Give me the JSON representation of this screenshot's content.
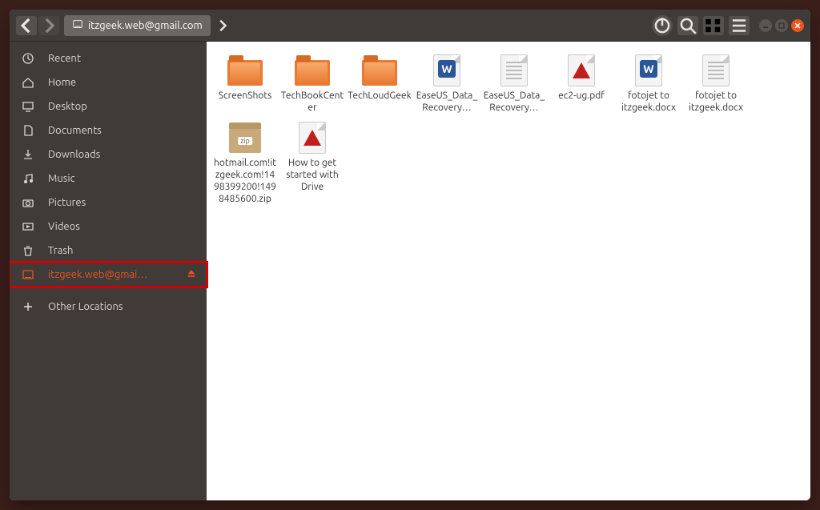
{
  "header": {
    "path_label": "itzgeek.web@gmail.com"
  },
  "sidebar": {
    "items": [
      {
        "name": "recent",
        "label": "Recent",
        "icon": "clock"
      },
      {
        "name": "home",
        "label": "Home",
        "icon": "home"
      },
      {
        "name": "desktop",
        "label": "Desktop",
        "icon": "desktop"
      },
      {
        "name": "documents",
        "label": "Documents",
        "icon": "doc"
      },
      {
        "name": "downloads",
        "label": "Downloads",
        "icon": "download"
      },
      {
        "name": "music",
        "label": "Music",
        "icon": "music"
      },
      {
        "name": "pictures",
        "label": "Pictures",
        "icon": "camera"
      },
      {
        "name": "videos",
        "label": "Videos",
        "icon": "video"
      },
      {
        "name": "trash",
        "label": "Trash",
        "icon": "trash"
      },
      {
        "name": "gdrive",
        "label": "itzgeek.web@gmai…",
        "icon": "drive",
        "active": true,
        "eject": true,
        "highlight": true
      },
      {
        "name": "other",
        "label": "Other Locations",
        "icon": "plus"
      }
    ]
  },
  "files": [
    {
      "name": "ScreenShots",
      "type": "folder"
    },
    {
      "name": "TechBookCenter",
      "type": "folder"
    },
    {
      "name": "TechLoudGeek",
      "type": "folder"
    },
    {
      "name": "EaseUS_Data_Recovery…",
      "type": "docw"
    },
    {
      "name": "EaseUS_Data_Recovery…",
      "type": "txt"
    },
    {
      "name": "ec2-ug.pdf",
      "type": "pdf"
    },
    {
      "name": "fotojet to itzgeek.docx",
      "type": "docw"
    },
    {
      "name": "fotojet to itzgeek.docx",
      "type": "txt"
    },
    {
      "name": "hotmail.com!itzgeek.com!1498399200!1498485600.zip",
      "type": "zip"
    },
    {
      "name": "How to get started with Drive",
      "type": "pdf"
    }
  ]
}
